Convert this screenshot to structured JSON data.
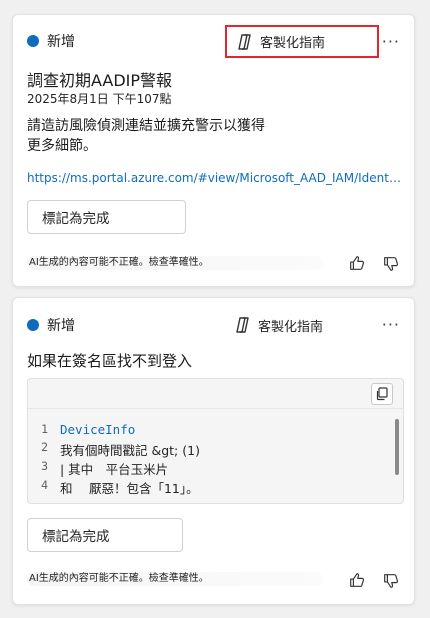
{
  "cards": [
    {
      "status": "新增",
      "guide_label": "客製化指南",
      "more": "···",
      "title": "調查初期AADIP警報",
      "timestamp": "2025年8月1日 下午107點",
      "description_line1": "請造訪風險偵測連結並擴充警示以獲得",
      "description_line2": "更多細節。",
      "link": "https://ms.portal.azure.com/#view/Microsoft_AAD_IAM/IdentityProtectionMenuBlade",
      "button": "標記為完成",
      "ai_note": "AI生成的內容可能不正確。檢查準確性。"
    },
    {
      "status": "新增",
      "guide_label": "客製化指南",
      "more": "···",
      "title": "如果在簽名區找不到登入",
      "code": [
        {
          "n": "1",
          "text": "DeviceInfo"
        },
        {
          "n": "2",
          "text": "我有個時間戳記 &gt; (1)"
        },
        {
          "n": "3",
          "text": "| 其中　平台玉米片"
        },
        {
          "n": "4",
          "text": "和　 厭惡！包含「11」。"
        }
      ],
      "button": "標記為完成",
      "ai_note": "AI生成的內容可能不正確。檢查準確性。"
    }
  ],
  "icons": {
    "status": "status-dot-icon",
    "guide": "copilot-icon",
    "copy": "copy-icon",
    "like": "thumbs-up-icon",
    "dislike": "thumbs-down-icon"
  },
  "colors": {
    "accent": "#0f6cbd",
    "highlight": "#e3262f"
  }
}
